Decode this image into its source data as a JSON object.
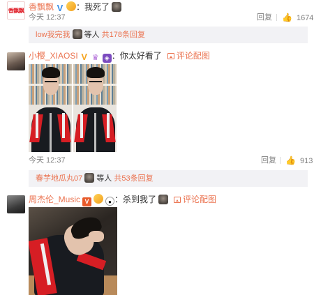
{
  "comments": [
    {
      "avatar_text": "香飘飘",
      "username": "香飘飘",
      "separator": "：",
      "text": "我死了",
      "time": "今天 12:37",
      "reply_label": "回复",
      "likes": "1674",
      "subreplies": {
        "user": "low我完我",
        "middle": " 等人 ",
        "count": "共178条回复"
      }
    },
    {
      "username": "小樱_XIAOSI",
      "separator": "：",
      "text": "你太好看了",
      "reply_with_pic": "评论配图",
      "time": "今天 12:37",
      "reply_label": "回复",
      "likes": "913",
      "subreplies": {
        "user": "春芋地瓜丸07",
        "middle": " 等人 ",
        "count": "共53条回复"
      }
    },
    {
      "username": "周杰伦_Music",
      "separator": "：",
      "text": "杀到我了",
      "reply_with_pic": "评论配图"
    }
  ],
  "colors": {
    "accent_orange": "#eb7350",
    "meta_gray": "#808080",
    "subreply_bg": "#f2f2f5"
  },
  "icons": [
    "verified-v-icon",
    "crown-icon",
    "vip-badge-icon",
    "like-thumb-icon",
    "picture-icon",
    "sticker-icon"
  ]
}
